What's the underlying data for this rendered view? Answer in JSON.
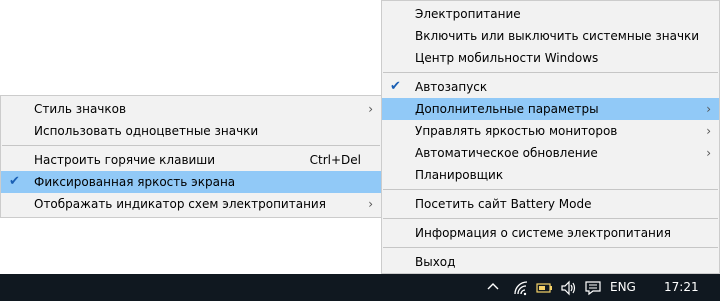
{
  "main_menu": {
    "group1": [
      {
        "label": "Электропитание"
      },
      {
        "label": "Включить или выключить системные значки"
      },
      {
        "label": "Центр мобильности Windows"
      }
    ],
    "group2": [
      {
        "label": "Автозапуск",
        "checked": true
      },
      {
        "label": "Дополнительные параметры",
        "submenu": true,
        "highlighted": true
      },
      {
        "label": "Управлять яркостью мониторов",
        "submenu": true
      },
      {
        "label": "Автоматическое обновление",
        "submenu": true
      },
      {
        "label": "Планировщик"
      }
    ],
    "group3": [
      {
        "label": "Посетить сайт Battery Mode"
      }
    ],
    "group4": [
      {
        "label": "Информация о системе электропитания"
      }
    ],
    "group5": [
      {
        "label": "Выход"
      }
    ]
  },
  "sub_menu": {
    "group1": [
      {
        "label": "Стиль значков",
        "submenu": true
      },
      {
        "label": "Использовать одноцветные значки"
      }
    ],
    "group2": [
      {
        "label": "Настроить горячие клавиши",
        "shortcut": "Ctrl+Del"
      },
      {
        "label": "Фиксированная яркость экрана",
        "checked": true,
        "highlighted": true
      },
      {
        "label": "Отображать индикатор схем электропитания",
        "submenu": true
      }
    ]
  },
  "glyphs": {
    "check": "✔",
    "arrow": "›",
    "chevron_up": "∧"
  },
  "taskbar": {
    "language": "ENG",
    "time": "17:21",
    "icons": [
      "chevron-up-icon",
      "wifi-icon",
      "battery-icon",
      "volume-icon",
      "notification-icon"
    ]
  },
  "colors": {
    "menu_bg": "#f2f2f2",
    "highlight": "#91c9f7",
    "taskbar": "#101820",
    "check": "#1a5fb4"
  }
}
